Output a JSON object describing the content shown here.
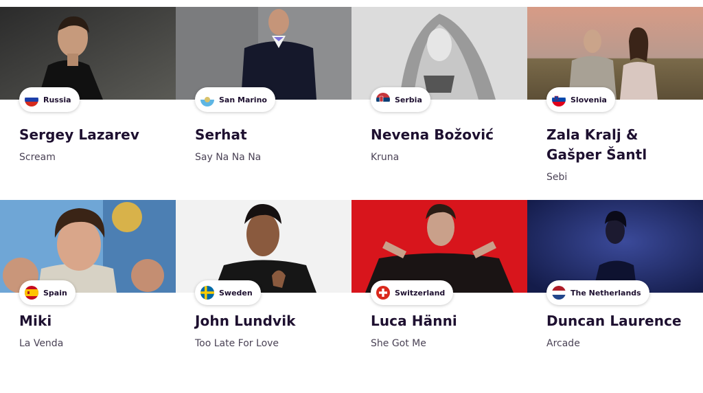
{
  "participants": [
    {
      "country": "Russia",
      "flag_icon": "russia-flag-icon",
      "artist": "Sergey Lazarev",
      "song": "Scream"
    },
    {
      "country": "San Marino",
      "flag_icon": "san-marino-flag-icon",
      "artist": "Serhat",
      "song": "Say Na Na Na"
    },
    {
      "country": "Serbia",
      "flag_icon": "serbia-flag-icon",
      "artist": "Nevena Božović",
      "song": "Kruna"
    },
    {
      "country": "Slovenia",
      "flag_icon": "slovenia-flag-icon",
      "artist": "Zala Kralj & Gašper Šantl",
      "song": "Sebi"
    },
    {
      "country": "Spain",
      "flag_icon": "spain-flag-icon",
      "artist": "Miki",
      "song": "La Venda"
    },
    {
      "country": "Sweden",
      "flag_icon": "sweden-flag-icon",
      "artist": "John Lundvik",
      "song": "Too Late For Love"
    },
    {
      "country": "Switzerland",
      "flag_icon": "switzerland-flag-icon",
      "artist": "Luca Hänni",
      "song": "She Got Me"
    },
    {
      "country": "The Netherlands",
      "flag_icon": "netherlands-flag-icon",
      "artist": "Duncan Laurence",
      "song": "Arcade"
    }
  ],
  "colors": {
    "text_dark": "#1e1030",
    "text_muted": "#4a4255",
    "tag_bg": "#ffffff"
  }
}
